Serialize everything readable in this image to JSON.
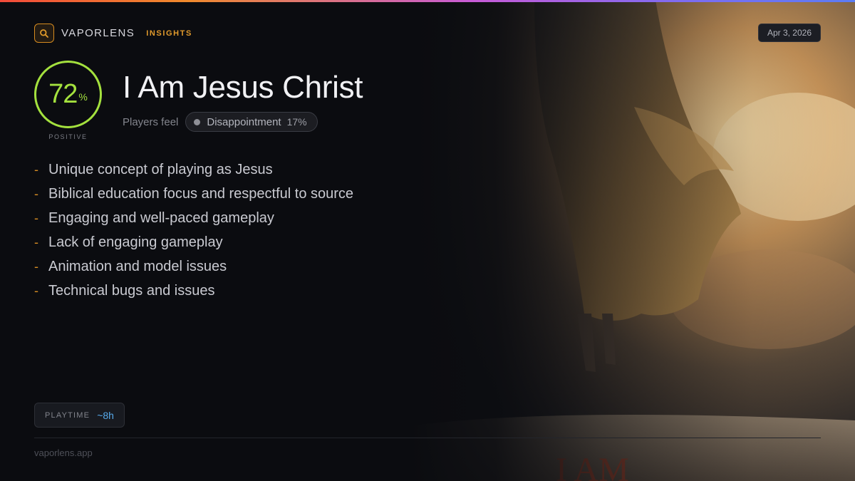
{
  "brand": {
    "name": "VAPORLENS",
    "tag": "INSIGHTS",
    "icon": "search-icon",
    "accent": "#d68b1f"
  },
  "date": "Apr 3, 2026",
  "score": {
    "value": "72",
    "unit": "%",
    "fraction": 0.72,
    "label": "POSITIVE",
    "color": "#a4e13e"
  },
  "game": {
    "title": "I Am Jesus Christ"
  },
  "sentiment": {
    "label": "Players feel",
    "emotion": "Disappointment",
    "percent": "17%"
  },
  "points": [
    "Unique concept of playing as Jesus",
    "Biblical education focus and respectful to source",
    "Engaging and well-paced gameplay",
    "Lack of engaging gameplay",
    "Animation and model issues",
    "Technical bugs and issues"
  ],
  "playtime": {
    "label": "PLAYTIME",
    "value": "~8h"
  },
  "footer": {
    "site": "vaporlens.app"
  }
}
